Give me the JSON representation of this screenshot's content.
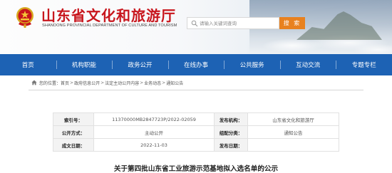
{
  "header": {
    "site_title": "山东省文化和旅游厅",
    "site_subtitle": "SHANDONG PROVINCIAL DEPARTMENT OF CULTURE AND TOURISM",
    "emblem_icon": "national-emblem-icon",
    "title_color": "#c8161d"
  },
  "search": {
    "placeholder": "请输入关键词查询",
    "button_label": "搜 索",
    "button_color": "#e8811f"
  },
  "nav": {
    "background": "#1d62b4",
    "items": [
      {
        "label": "首页"
      },
      {
        "label": "机构职能"
      },
      {
        "label": "政务公开"
      },
      {
        "label": "在线办事"
      },
      {
        "label": "公共服务"
      },
      {
        "label": "互动交流"
      },
      {
        "label": "专题专栏"
      }
    ]
  },
  "breadcrumb": {
    "prefix": "您的位置：",
    "items": [
      "首页",
      "政府信息公开",
      "法定主动公开内容",
      "业务动态",
      "通知公告"
    ],
    "separator": ">"
  },
  "info_table": {
    "index_label": "索引号：",
    "index_value": "11370000MB2847723P/2022-02059",
    "publisher_label": "发布机构：",
    "publisher_value": "山东省文化和旅游厅",
    "method_label": "公开方式：",
    "method_value": "主动公开",
    "category_label": "组配分类：",
    "category_value": "通知公告",
    "date_label": "成文日期：",
    "date_value": "2022-11-03",
    "date2_label": "发布日期：",
    "date2_value": ""
  },
  "document": {
    "title": "关于第四批山东省工业旅游示范基地拟入选名单的公示"
  }
}
